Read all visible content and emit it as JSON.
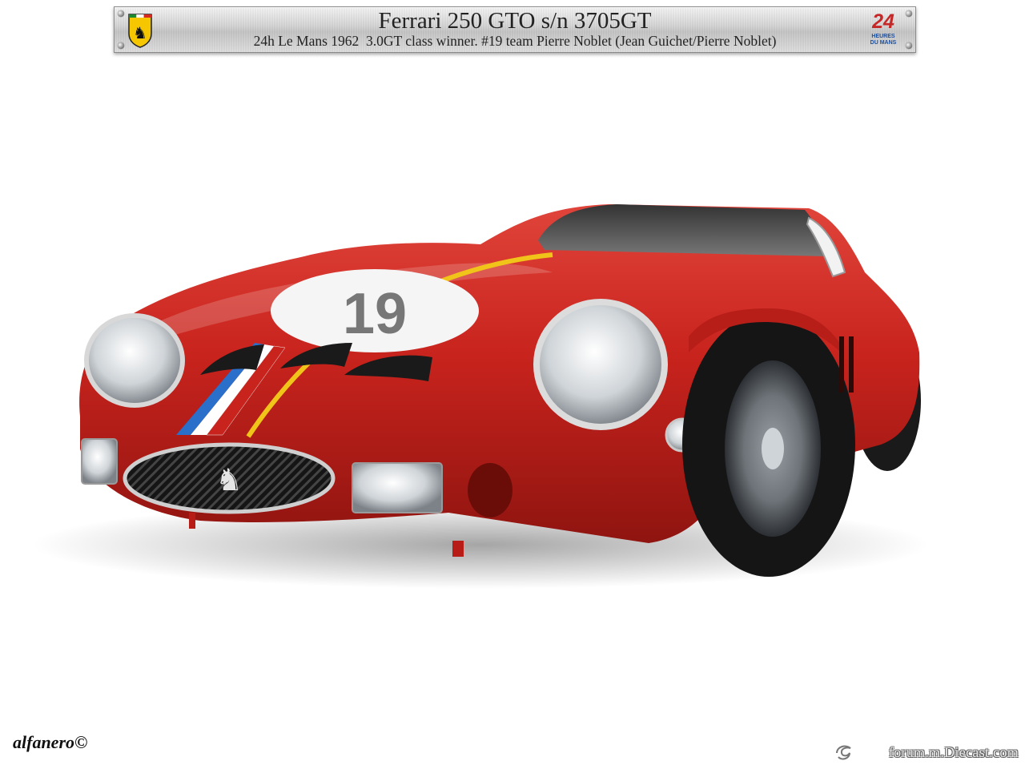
{
  "plate": {
    "title": "Ferrari 250 GTO s/n 3705GT",
    "subtitle": "24h Le Mans 1962  3.0GT class winner. #19 team Pierre Noblet (Jean Guichet/Pierre Noblet)",
    "lemans_badge": {
      "number": "24",
      "line1": "HEURES",
      "line2": "DU MANS"
    }
  },
  "car": {
    "race_number": "19"
  },
  "signature": "alfanero©",
  "site_watermark": "forum.m.Diecast.com",
  "colors": {
    "car_red": "#c8231d",
    "stripe_blue": "#2a6fc9",
    "stripe_yellow": "#f0c419",
    "plate_metal": "#d0d0d0"
  }
}
